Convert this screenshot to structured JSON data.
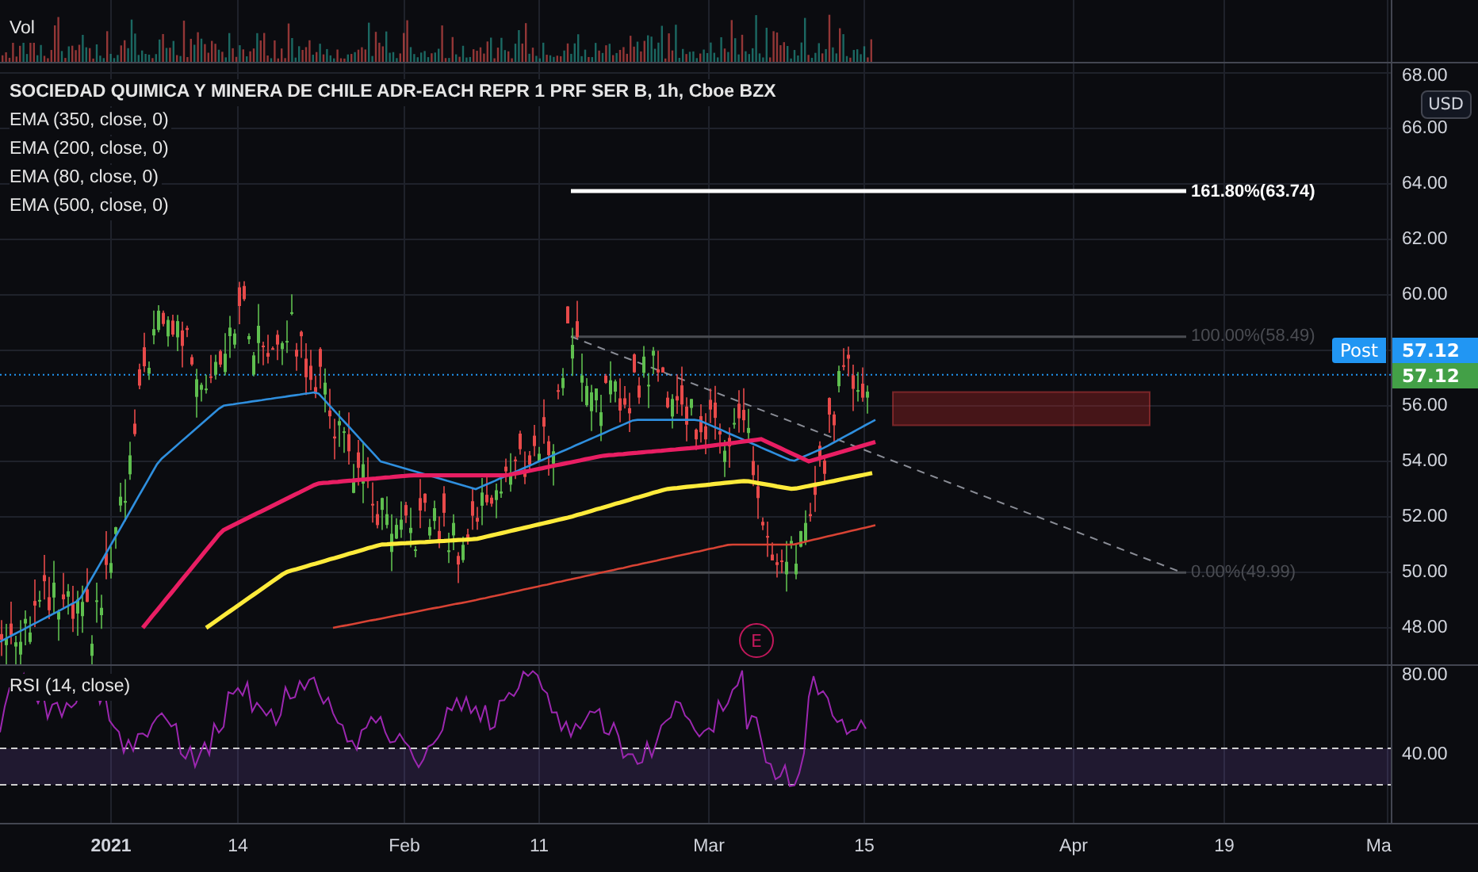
{
  "volume": {
    "label": "Vol"
  },
  "chart": {
    "title": "SOCIEDAD QUIMICA Y MINERA DE CHILE ADR-EACH REPR 1 PRF SER B, 1h, Cboe BZX",
    "indicators": [
      "EMA (350, close, 0)",
      "EMA (200, close, 0)",
      "EMA (80, close, 0)",
      "EMA (500, close, 0)"
    ],
    "fib_levels": [
      {
        "label": "161.80%(63.74)",
        "emphasized": true
      },
      {
        "label": "100.00%(58.49)",
        "emphasized": false
      },
      {
        "label": "0.00%(49.99)",
        "emphasized": false
      }
    ],
    "event_marker": "E",
    "post_badge": "Post"
  },
  "price_axis": {
    "currency": "USD",
    "ticks": [
      "68.00",
      "66.00",
      "64.00",
      "62.00",
      "60.00",
      "56.00",
      "54.00",
      "52.00",
      "50.00",
      "48.00"
    ],
    "last_prices": [
      {
        "value": "57.12",
        "kind": "post"
      },
      {
        "value": "57.12",
        "kind": "last"
      }
    ]
  },
  "rsi": {
    "label": "RSI (14, close)",
    "ticks": [
      "80.00",
      "40.00"
    ]
  },
  "time_axis": {
    "ticks": [
      "2021",
      "14",
      "Feb",
      "11",
      "Mar",
      "15",
      "Apr",
      "19",
      "Ma"
    ]
  }
}
